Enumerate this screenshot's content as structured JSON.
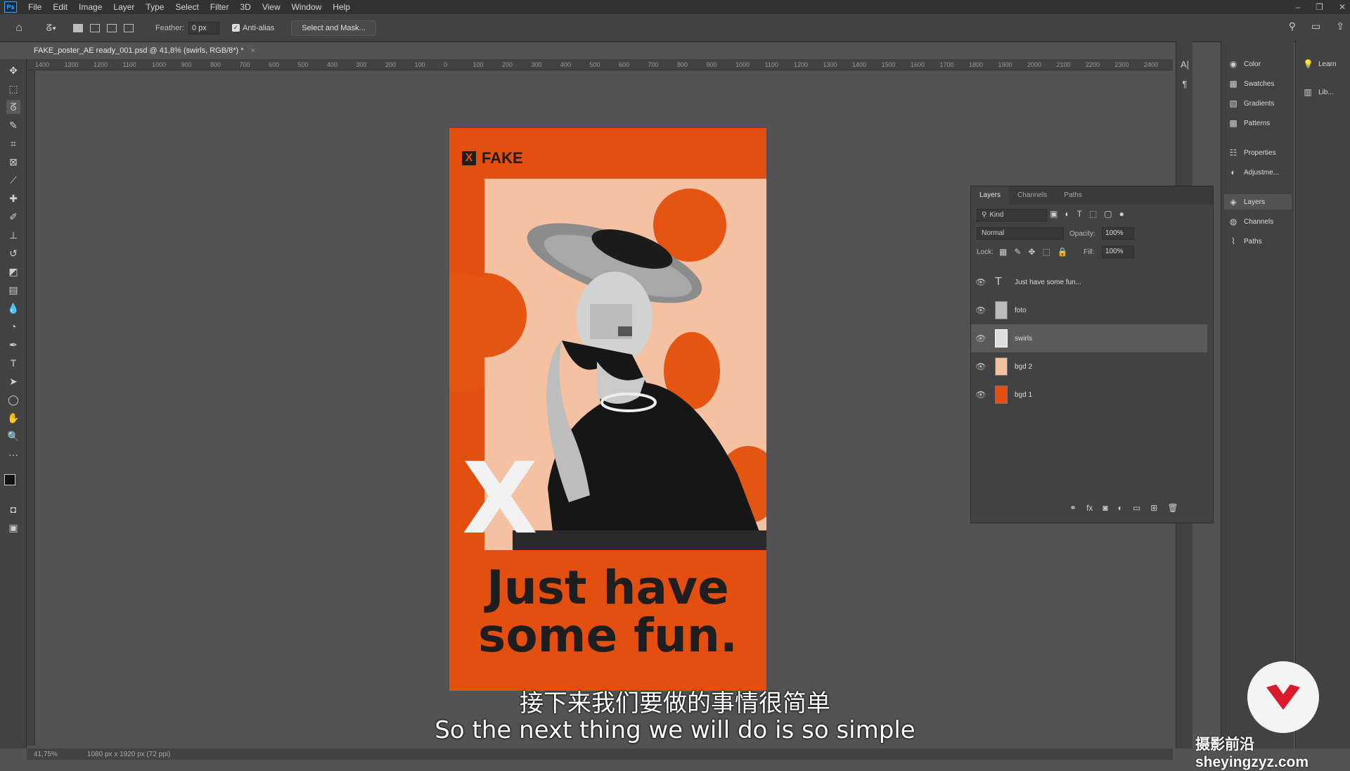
{
  "menubar": {
    "items": [
      "File",
      "Edit",
      "Image",
      "Layer",
      "Type",
      "Select",
      "Filter",
      "3D",
      "View",
      "Window",
      "Help"
    ]
  },
  "options": {
    "feather_label": "Feather:",
    "feather_value": "0 px",
    "antialias_label": "Anti-alias",
    "select_mask_label": "Select and Mask..."
  },
  "document": {
    "tab_title": "FAKE_poster_AE ready_001.psd @ 41,8% (swirls, RGB/8*) *"
  },
  "ruler": {
    "labels": [
      "1400",
      "1300",
      "1200",
      "1100",
      "1000",
      "900",
      "800",
      "700",
      "600",
      "500",
      "400",
      "300",
      "200",
      "100",
      "0",
      "100",
      "200",
      "300",
      "400",
      "500",
      "600",
      "700",
      "800",
      "900",
      "1000",
      "1100",
      "1200",
      "1300",
      "1400",
      "1500",
      "1600",
      "1700",
      "1800",
      "1900",
      "2000",
      "2100",
      "2200",
      "2300",
      "2400"
    ]
  },
  "poster": {
    "brand": "FAKE",
    "headline_line1": "Just have",
    "headline_line2": "some fun.",
    "big_letter": "X",
    "colors": {
      "orange": "#e24f10",
      "peach": "#f4c1a2",
      "ink": "#1e1e1e"
    }
  },
  "panels": {
    "items": [
      {
        "icon": "color-icon",
        "label": "Color"
      },
      {
        "icon": "swatches-icon",
        "label": "Swatches"
      },
      {
        "icon": "gradients-icon",
        "label": "Gradients"
      },
      {
        "icon": "patterns-icon",
        "label": "Patterns"
      },
      {
        "icon": "properties-icon",
        "label": "Properties"
      },
      {
        "icon": "adjustments-icon",
        "label": "Adjustme..."
      },
      {
        "icon": "layers-icon",
        "label": "Layers"
      },
      {
        "icon": "channels-icon",
        "label": "Channels"
      },
      {
        "icon": "paths-icon",
        "label": "Paths"
      }
    ],
    "learn_label": "Learn",
    "libraries_label": "Lib..."
  },
  "layers_panel": {
    "tabs": [
      "Layers",
      "Channels",
      "Paths"
    ],
    "kind_label": "Kind",
    "blend_mode": "Normal",
    "opacity_label": "Opacity:",
    "opacity_value": "100%",
    "lock_label": "Lock:",
    "fill_label": "Fill:",
    "fill_value": "100%",
    "layers": [
      {
        "name": "Just have some fun...",
        "type": "text"
      },
      {
        "name": "foto",
        "type": "image"
      },
      {
        "name": "swirls",
        "type": "image",
        "selected": true
      },
      {
        "name": "bgd 2",
        "type": "fill",
        "color": "#f4c1a2"
      },
      {
        "name": "bgd 1",
        "type": "fill",
        "color": "#e24f10"
      }
    ]
  },
  "status": {
    "zoom": "41,75%",
    "size": "1080 px x 1920 px (72 ppi)"
  },
  "subtitles": {
    "cn": "接下来我们要做的事情很简单",
    "en": "So the next thing we will do is so simple"
  },
  "watermark": {
    "text": "摄影前沿sheyingzyz.com"
  }
}
